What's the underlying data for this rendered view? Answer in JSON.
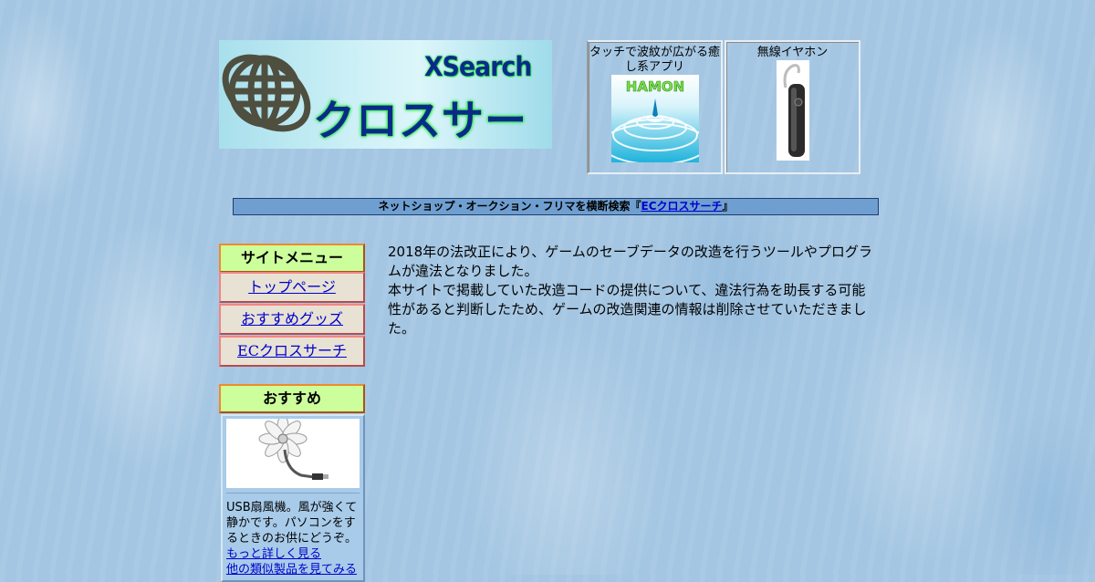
{
  "logo": {
    "text_en": "XSearch",
    "text_ja": "クロスサーチ",
    "colors": {
      "text": "#0a2a8a",
      "glow": "#2ee64a",
      "globe": "#555544"
    }
  },
  "ads": [
    {
      "title": "タッチで波紋が広がる癒し系アプリ",
      "image_label": "HAMON",
      "image_icon": "water-ripple-app-image"
    },
    {
      "title": "無線イヤホン",
      "image_icon": "wireless-earphone-image"
    }
  ],
  "notice": {
    "text": "ネットショップ・オークション・フリマを横断検索",
    "open": "『",
    "link": "ECクロスサーチ",
    "close": "』"
  },
  "menu": {
    "heading": "サイトメニュー",
    "items": [
      {
        "label": "トップページ"
      },
      {
        "label": "おすすめグッズ"
      },
      {
        "label": "ECクロスサーチ"
      }
    ]
  },
  "recommend": {
    "heading": "おすすめ",
    "image_icon": "usb-fan-image",
    "description": "USB扇風機。風が強くて静かです。パソコンをするときのお供にどうぞ。",
    "more_link": "もっと詳しく見る",
    "similar_link": "他の類似製品を見てみる"
  },
  "message": {
    "paragraph1": "2018年の法改正により、ゲームのセーブデータの改造を行うツールやプログラムが違法となりました。",
    "paragraph2": "本サイトで掲載していた改造コードの提供について、違法行為を助長する可能性があると判断したため、ゲームの改造関連の情報は削除させていただきました。"
  }
}
